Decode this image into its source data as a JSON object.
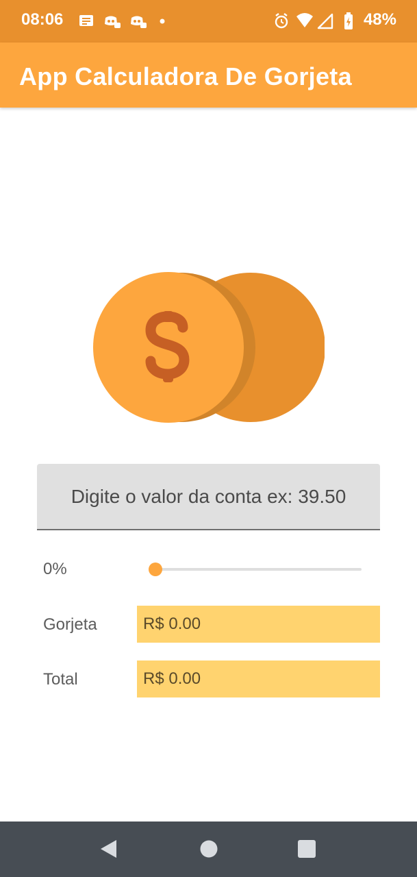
{
  "status_bar": {
    "time": "08:06",
    "battery": "48%",
    "left_icons": [
      "notes-icon",
      "discord-icon",
      "discord-icon",
      "dot-icon"
    ],
    "right_icons": [
      "alarm-icon",
      "wifi-icon",
      "signal-icon",
      "battery-icon"
    ]
  },
  "app_bar": {
    "title": "App Calculadora De Gorjeta"
  },
  "hero": {
    "icon": "coins-dollar-icon"
  },
  "bill": {
    "placeholder": "Digite o valor da conta ex: 39.50",
    "value": ""
  },
  "tip": {
    "percent_label": "0%",
    "percent_value": 0
  },
  "results": {
    "tip_label": "Gorjeta",
    "tip_value": "R$ 0.00",
    "total_label": "Total",
    "total_value": "R$ 0.00"
  },
  "nav": {
    "buttons": [
      "back-icon",
      "home-icon",
      "recents-icon"
    ]
  },
  "colors": {
    "status_bar": "#E8902D",
    "accent": "#FDA63E",
    "result_box": "#FFD36F",
    "nav_bar": "#474D54",
    "dollar": "#C65F24"
  }
}
